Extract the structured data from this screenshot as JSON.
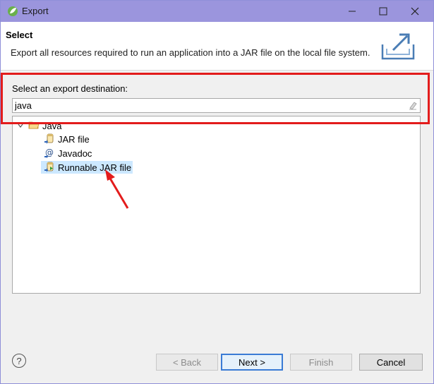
{
  "window": {
    "title": "Export"
  },
  "header": {
    "title": "Select",
    "description": "Export all resources required to run an application into a JAR file on the local file system."
  },
  "destination": {
    "label": "Select an export destination:",
    "filter_value": "java"
  },
  "tree": {
    "category": "Java",
    "items": [
      {
        "label": "JAR file",
        "icon": "jar-file-icon"
      },
      {
        "label": "Javadoc",
        "icon": "javadoc-icon"
      },
      {
        "label": "Runnable JAR file",
        "icon": "runnable-jar-icon",
        "selected": true
      }
    ]
  },
  "buttons": {
    "back": "< Back",
    "next": "Next >",
    "finish": "Finish",
    "cancel": "Cancel"
  },
  "colors": {
    "titlebar": "#9b95dd",
    "annotation": "#e31c1c",
    "selection": "#cce8ff"
  }
}
